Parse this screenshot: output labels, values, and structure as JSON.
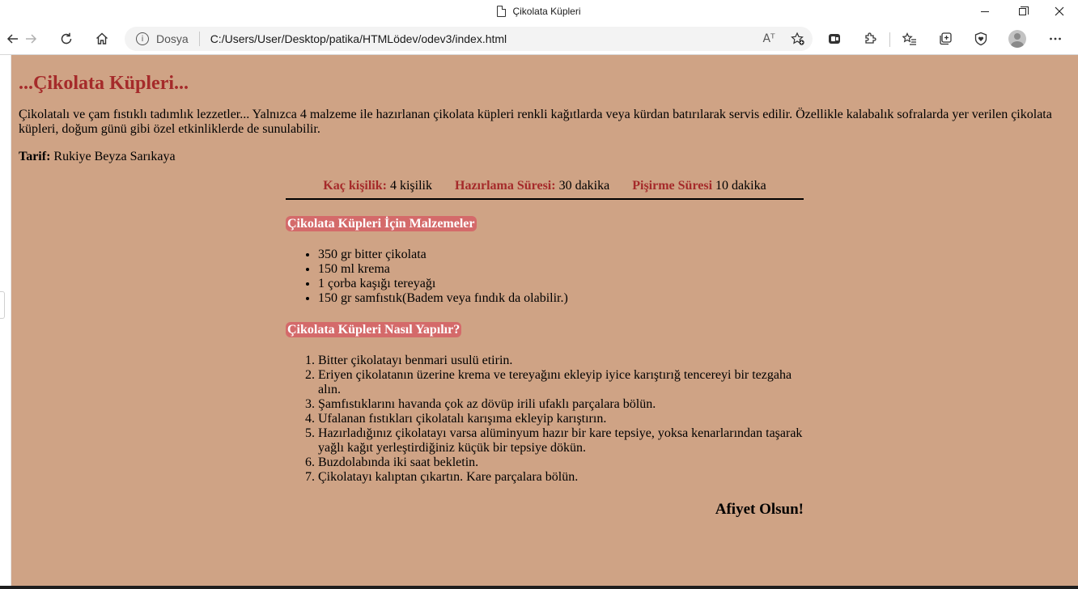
{
  "window": {
    "title": "Çikolata Küpleri"
  },
  "toolbar": {
    "address_label": "Dosya",
    "url": "C:/Users/User/Desktop/patika/HTMLödev/odev3/index.html",
    "read_aloud_glyph": "Aᵀ"
  },
  "page": {
    "heading": "...Çikolata Küpleri...",
    "intro": "Çikolatalı ve çam fıstıklı tadımlık lezzetler... Yalnızca 4 malzeme ile hazırlanan çikolata küpleri renkli kağıtlarda veya kürdan batırılarak servis edilir. Özellikle kalabalık sofralarda yer verilen çikolata küpleri, doğum günü gibi özel etkinliklerde de sunulabilir.",
    "author_label": "Tarif:",
    "author_name": " Rukiye Beyza Sarıkaya",
    "info": {
      "servings_label": "Kaç kişilik:",
      "servings_value": " 4 kişilik",
      "prep_label": "Hazırlama Süresi:",
      "prep_value": " 30 dakika",
      "cook_label": "Pişirme Süresi",
      "cook_value": " 10 dakika"
    },
    "ingredients_heading": "Çikolata Küpleri İçin Malzemeler",
    "ingredients": [
      "350 gr bitter çikolata",
      "150 ml krema",
      "1 çorba kaşığı tereyağı",
      "150 gr samfıstık(Badem veya fındık da olabilir.)"
    ],
    "steps_heading": "Çikolata Küpleri Nasıl Yapılır?",
    "steps": [
      "Bitter çikolatayı benmari usulü etirin.",
      "Eriyen çikolatanın üzerine krema ve tereyağını ekleyip iyice karıştırığ tencereyi bir tezgaha alın.",
      "Şamfıstıklarını havanda çok az dövüp irili ufaklı parçalara bölün.",
      "Ufalanan fıstıkları çikolatalı karışıma ekleyip karıştırın.",
      "Hazırladığınız çikolatayı varsa alüminyum hazır bir kare tepsiye, yoksa kenarlarından taşarak yağlı kağıt yerleştirdiğiniz küçük bir tepsiye dökün.",
      "Buzdolabında iki saat bekletin.",
      "Çikolatayı kalıptan çıkartın. Kare parçalara bölün."
    ],
    "closing": "Afiyet Olsun!"
  },
  "colors": {
    "page_background": "#cfa385",
    "heading": "#a52a2a",
    "section_highlight": "#d46a6a"
  }
}
